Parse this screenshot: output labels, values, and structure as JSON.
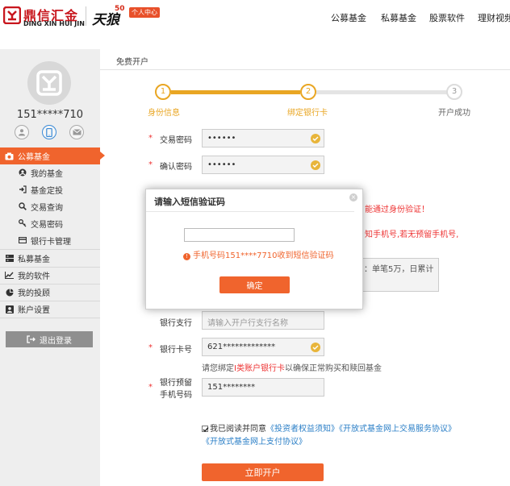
{
  "brand": {
    "name_cn": "鼎信汇金",
    "name_en": "DING XIN HUI JIN",
    "partner_cn": "天狼",
    "partner_num": "50",
    "user_center": "个人中心"
  },
  "nav": [
    "公募基金",
    "私募基金",
    "股票软件",
    "理财视频"
  ],
  "user": {
    "phone": "151*****710"
  },
  "sidebar": {
    "sections": [
      {
        "label": "公募基金",
        "active": true,
        "items": [
          "我的基金",
          "基金定投",
          "交易查询",
          "交易密码",
          "银行卡管理"
        ]
      },
      {
        "label": "私募基金"
      },
      {
        "label": "我的软件"
      },
      {
        "label": "我的投顾"
      },
      {
        "label": "账户设置"
      }
    ],
    "logout": "退出登录"
  },
  "page": {
    "title": "免费开户",
    "steps": [
      {
        "num": "1",
        "label": "身份信息",
        "done": true
      },
      {
        "num": "2",
        "label": "绑定银行卡",
        "done": true
      },
      {
        "num": "3",
        "label": "开户成功",
        "done": false
      }
    ],
    "form": {
      "trade_password_label": "交易密码",
      "trade_password_value": "••••••",
      "confirm_password_label": "确认密码",
      "confirm_password_value": "••••••",
      "bank_branch_label": "银行支行",
      "bank_branch_placeholder": "请输入开户行支行名称",
      "card_label": "银行卡号",
      "card_value": "621*************",
      "card_hint_prefix": "请您绑定",
      "card_hint_highlight": "I类账户银行卡",
      "card_hint_suffix": "以确保正常购买和赎回基金",
      "phone_label_line1": "银行预留",
      "phone_label_line2": "手机号码",
      "phone_value": "151********"
    },
    "partial_notes": {
      "verify": "能通过身份验证！",
      "phone_notice": "知手机号,若无预留手机号,",
      "limit": "：单笔5万，日累计"
    },
    "agreement": {
      "prefix": "我已阅读并同意",
      "link1": "《投资者权益须知》",
      "link2": "《开放式基金网上交易服务协议》",
      "link3": "《开放式基金网上支付协议》"
    },
    "submit": "立即开户"
  },
  "modal": {
    "title": "请输入短信验证码",
    "error": "手机号码151****7710收到短信验证码",
    "confirm": "确定",
    "close": "×"
  },
  "colors": {
    "accent": "#f0642d",
    "step": "#e9a623",
    "brand_red": "#c8161d",
    "link": "#2b7fc7"
  }
}
